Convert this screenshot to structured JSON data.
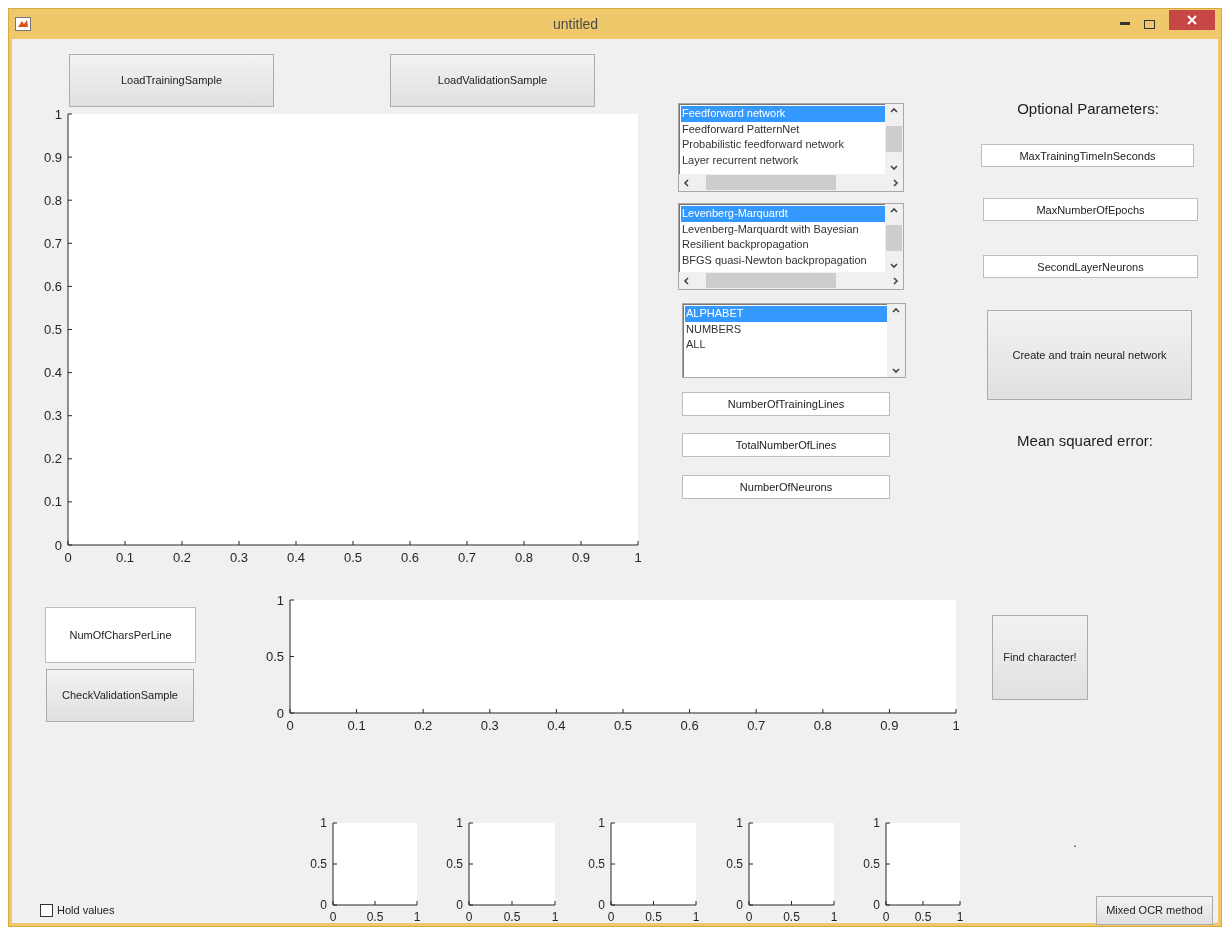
{
  "window": {
    "title": "untitled"
  },
  "controls": [
    {
      "kind": "button",
      "label": "LoadTrainingSample"
    },
    {
      "kind": "button",
      "label": "LoadValidationSample"
    },
    {
      "kind": "listbox",
      "h_scrollbar": true,
      "items": [
        {
          "label": "Feedforward network",
          "selected": true
        },
        {
          "label": "Feedforward PatternNet",
          "selected": false
        },
        {
          "label": "Probabilistic feedforward network",
          "selected": false
        },
        {
          "label": "Layer recurrent network",
          "selected": false
        }
      ]
    },
    {
      "kind": "listbox",
      "h_scrollbar": true,
      "items": [
        {
          "label": "Levenberg-Marquardt",
          "selected": true
        },
        {
          "label": "Levenberg-Marquardt with Bayesian",
          "selected": false
        },
        {
          "label": "Resilient backpropagation",
          "selected": false
        },
        {
          "label": "BFGS quasi-Newton backpropagation",
          "selected": false
        }
      ]
    },
    {
      "kind": "listbox",
      "h_scrollbar": false,
      "items": [
        {
          "label": "ALPHABET",
          "selected": true
        },
        {
          "label": "NUMBERS",
          "selected": false
        },
        {
          "label": "ALL",
          "selected": false
        }
      ]
    },
    {
      "kind": "field",
      "value": "NumberOfTrainingLines"
    },
    {
      "kind": "field",
      "value": "TotalNumberOfLines"
    },
    {
      "kind": "field",
      "value": "NumberOfNeurons"
    },
    {
      "kind": "heading",
      "text": "Optional Parameters:"
    },
    {
      "kind": "field",
      "value": "MaxTrainingTimeInSeconds"
    },
    {
      "kind": "field",
      "value": "MaxNumberOfEpochs"
    },
    {
      "kind": "field",
      "value": "SecondLayerNeurons"
    },
    {
      "kind": "button",
      "label": "Create and train neural network"
    },
    {
      "kind": "heading",
      "text": "Mean squared error:"
    },
    {
      "kind": "field",
      "value": "NumOfCharsPerLine"
    },
    {
      "kind": "button",
      "label": "CheckValidationSample"
    },
    {
      "kind": "button",
      "label": "Find character!"
    },
    {
      "kind": "text",
      "text": "."
    },
    {
      "kind": "checkbox",
      "label": "Hold values",
      "checked": false
    },
    {
      "kind": "button",
      "label": "Mixed OCR method"
    }
  ],
  "axes": [
    {
      "chart_data": {
        "type": "line",
        "xlim": [
          0,
          1
        ],
        "ylim": [
          0,
          1
        ],
        "xticks": [
          {
            "value": 0,
            "label": "0"
          },
          {
            "value": 0.1,
            "label": "0.1"
          },
          {
            "value": 0.2,
            "label": "0.2"
          },
          {
            "value": 0.3,
            "label": "0.3"
          },
          {
            "value": 0.4,
            "label": "0.4"
          },
          {
            "value": 0.5,
            "label": "0.5"
          },
          {
            "value": 0.6,
            "label": "0.6"
          },
          {
            "value": 0.7,
            "label": "0.7"
          },
          {
            "value": 0.8,
            "label": "0.8"
          },
          {
            "value": 0.9,
            "label": "0.9"
          },
          {
            "value": 1,
            "label": "1"
          }
        ],
        "yticks": [
          {
            "value": 0,
            "label": "0"
          },
          {
            "value": 0.1,
            "label": "0.1"
          },
          {
            "value": 0.2,
            "label": "0.2"
          },
          {
            "value": 0.3,
            "label": "0.3"
          },
          {
            "value": 0.4,
            "label": "0.4"
          },
          {
            "value": 0.5,
            "label": "0.5"
          },
          {
            "value": 0.6,
            "label": "0.6"
          },
          {
            "value": 0.7,
            "label": "0.7"
          },
          {
            "value": 0.8,
            "label": "0.8"
          },
          {
            "value": 0.9,
            "label": "0.9"
          },
          {
            "value": 1,
            "label": "1"
          }
        ]
      }
    },
    {
      "chart_data": {
        "type": "line",
        "xlim": [
          0,
          1
        ],
        "ylim": [
          0,
          1
        ],
        "xticks": [
          {
            "value": 0,
            "label": "0"
          },
          {
            "value": 0.1,
            "label": "0.1"
          },
          {
            "value": 0.2,
            "label": "0.2"
          },
          {
            "value": 0.3,
            "label": "0.3"
          },
          {
            "value": 0.4,
            "label": "0.4"
          },
          {
            "value": 0.5,
            "label": "0.5"
          },
          {
            "value": 0.6,
            "label": "0.6"
          },
          {
            "value": 0.7,
            "label": "0.7"
          },
          {
            "value": 0.8,
            "label": "0.8"
          },
          {
            "value": 0.9,
            "label": "0.9"
          },
          {
            "value": 1,
            "label": "1"
          }
        ],
        "yticks": [
          {
            "value": 0,
            "label": "0"
          },
          {
            "value": 0.5,
            "label": "0.5"
          },
          {
            "value": 1,
            "label": "1"
          }
        ]
      }
    },
    {
      "chart_data": {
        "type": "line",
        "xlim": [
          0,
          1
        ],
        "ylim": [
          0,
          1
        ],
        "xticks": [
          {
            "value": 0,
            "label": "0"
          },
          {
            "value": 0.5,
            "label": "0.5"
          },
          {
            "value": 1,
            "label": "1"
          }
        ],
        "yticks": [
          {
            "value": 0,
            "label": "0"
          },
          {
            "value": 0.5,
            "label": "0.5"
          },
          {
            "value": 1,
            "label": "1"
          }
        ]
      }
    },
    {
      "chart_data": {
        "type": "line",
        "xlim": [
          0,
          1
        ],
        "ylim": [
          0,
          1
        ],
        "xticks": [
          {
            "value": 0,
            "label": "0"
          },
          {
            "value": 0.5,
            "label": "0.5"
          },
          {
            "value": 1,
            "label": "1"
          }
        ],
        "yticks": [
          {
            "value": 0,
            "label": "0"
          },
          {
            "value": 0.5,
            "label": "0.5"
          },
          {
            "value": 1,
            "label": "1"
          }
        ]
      }
    },
    {
      "chart_data": {
        "type": "line",
        "xlim": [
          0,
          1
        ],
        "ylim": [
          0,
          1
        ],
        "xticks": [
          {
            "value": 0,
            "label": "0"
          },
          {
            "value": 0.5,
            "label": "0.5"
          },
          {
            "value": 1,
            "label": "1"
          }
        ],
        "yticks": [
          {
            "value": 0,
            "label": "0"
          },
          {
            "value": 0.5,
            "label": "0.5"
          },
          {
            "value": 1,
            "label": "1"
          }
        ]
      }
    },
    {
      "chart_data": {
        "type": "line",
        "xlim": [
          0,
          1
        ],
        "ylim": [
          0,
          1
        ],
        "xticks": [
          {
            "value": 0,
            "label": "0"
          },
          {
            "value": 0.5,
            "label": "0.5"
          },
          {
            "value": 1,
            "label": "1"
          }
        ],
        "yticks": [
          {
            "value": 0,
            "label": "0"
          },
          {
            "value": 0.5,
            "label": "0.5"
          },
          {
            "value": 1,
            "label": "1"
          }
        ]
      }
    },
    {
      "chart_data": {
        "type": "line",
        "xlim": [
          0,
          1
        ],
        "ylim": [
          0,
          1
        ],
        "xticks": [
          {
            "value": 0,
            "label": "0"
          },
          {
            "value": 0.5,
            "label": "0.5"
          },
          {
            "value": 1,
            "label": "1"
          }
        ],
        "yticks": [
          {
            "value": 0,
            "label": "0"
          },
          {
            "value": 0.5,
            "label": "0.5"
          },
          {
            "value": 1,
            "label": "1"
          }
        ]
      }
    }
  ]
}
